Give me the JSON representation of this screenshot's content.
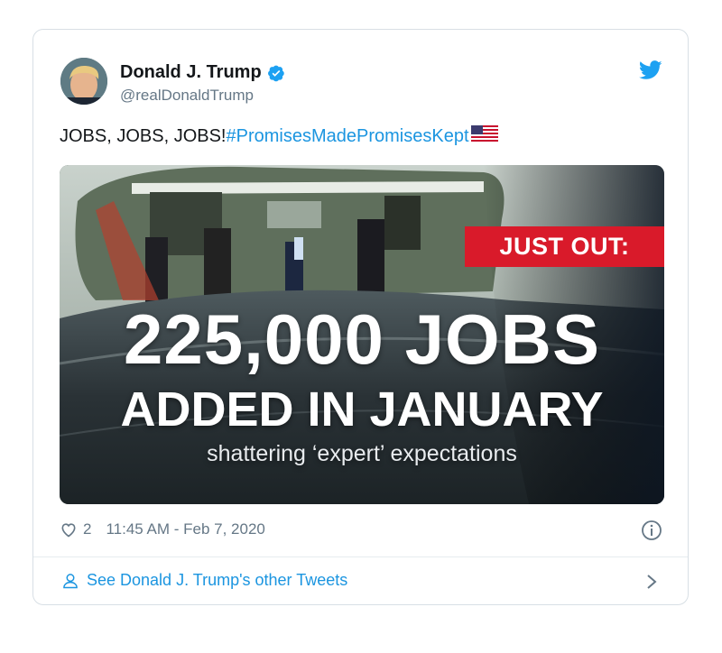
{
  "tweet": {
    "author_name": "Donald J. Trump",
    "handle": "@realDonaldTrump",
    "text_plain": "JOBS, JOBS, JOBS!",
    "hashtag": "#PromisesMadePromisesKept",
    "likes": "2",
    "timestamp": "11:45 AM - Feb 7, 2020",
    "footer_link": "See Donald J. Trump's other Tweets"
  },
  "media": {
    "badge": "JUST OUT:",
    "headline_1": "225,000 JOBS",
    "headline_2": "ADDED IN JANUARY",
    "subline": "shattering ‘expert’ expectations"
  },
  "colors": {
    "link_blue": "#1b95e0",
    "twitter_blue": "#1da1f2",
    "badge_red": "#d91a2a",
    "text_gray": "#657786"
  },
  "icons": [
    "avatar",
    "verified-badge-icon",
    "twitter-bird-icon",
    "us-flag-icon",
    "heart-icon",
    "info-icon",
    "person-icon",
    "chevron-right-icon"
  ]
}
